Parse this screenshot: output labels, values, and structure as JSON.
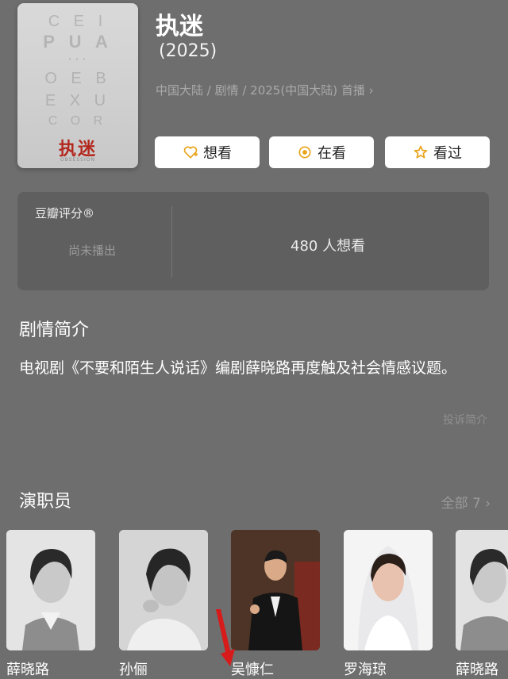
{
  "poster": {
    "faint_lines": [
      "C E I",
      "P U A",
      "• • •",
      "O E B",
      "E X U",
      "C O R"
    ],
    "title_text": "执迷",
    "sub_text": "OBSESSION"
  },
  "header": {
    "title": "执迷",
    "year": "(2025)",
    "meta": "中国大陆 / 剧情 / 2025(中国大陆) 首播 ›"
  },
  "actions": {
    "want_label": "想看",
    "watching_label": "在看",
    "watched_label": "看过"
  },
  "rating": {
    "label": "豆瓣评分®",
    "status": "尚未播出",
    "want_count": "480 人想看"
  },
  "plot": {
    "title": "剧情简介",
    "text": "电视剧《不要和陌生人说话》编剧薛晓路再度触及社会情感议题。",
    "report": "投诉简介"
  },
  "cast": {
    "title": "演职员",
    "all_label": "全部 7 ›",
    "members": [
      {
        "name": "薛晓路"
      },
      {
        "name": "孙俪"
      },
      {
        "name": "吴慷仁"
      },
      {
        "name": "罗海琼"
      },
      {
        "name": "薛晓路"
      }
    ]
  },
  "colors": {
    "background": "#6e6e6e",
    "card": "#5f5f5f",
    "accent_icon": "#e8a319",
    "poster_title": "#b3281e",
    "arrow": "#d71a1a"
  }
}
